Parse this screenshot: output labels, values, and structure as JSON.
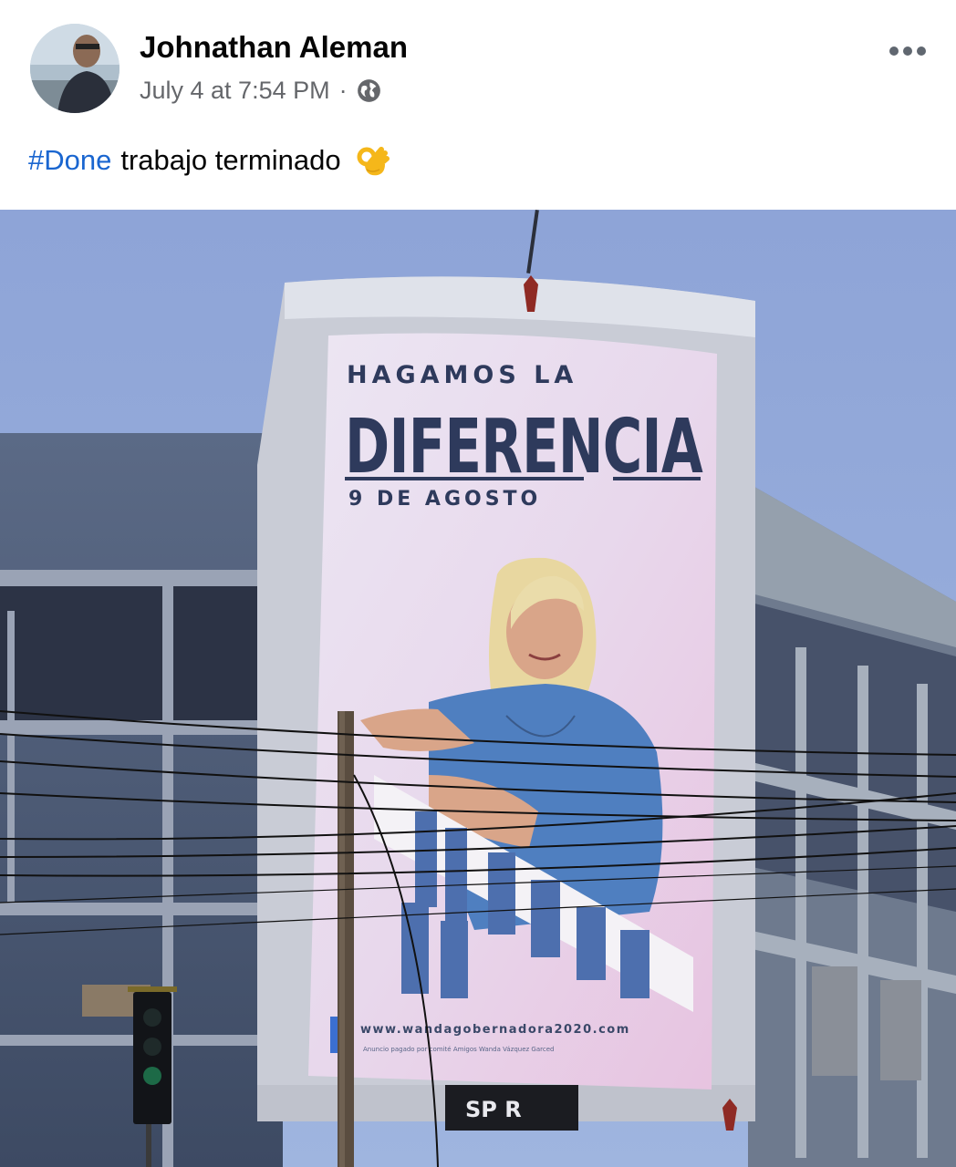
{
  "post": {
    "author": "Johnathan Aleman",
    "timestamp": "July 4 at 7:54 PM",
    "separator": "·",
    "privacy_icon": "globe-icon",
    "more_icon": "more-dots-icon",
    "caption_hashtag": "#Done",
    "caption_text": "trabajo terminado",
    "caption_emoji": "ok-hand-emoji"
  },
  "photo": {
    "billboard": {
      "line1": "HAGAMOS LA",
      "line2": "DIFERENCIA",
      "date": "9 DE AGOSTO",
      "url": "www.wandagobernadora2020.com",
      "disclaimer": "Anuncio pagado por comité Amigos Wanda Vázquez Garced"
    },
    "store_sign": "SP  R"
  },
  "colors": {
    "hashtag": "#1a66d0",
    "sky": "#8fa6d8",
    "billboard_text": "#2e3a5c",
    "blouse": "#4f7fc0"
  }
}
